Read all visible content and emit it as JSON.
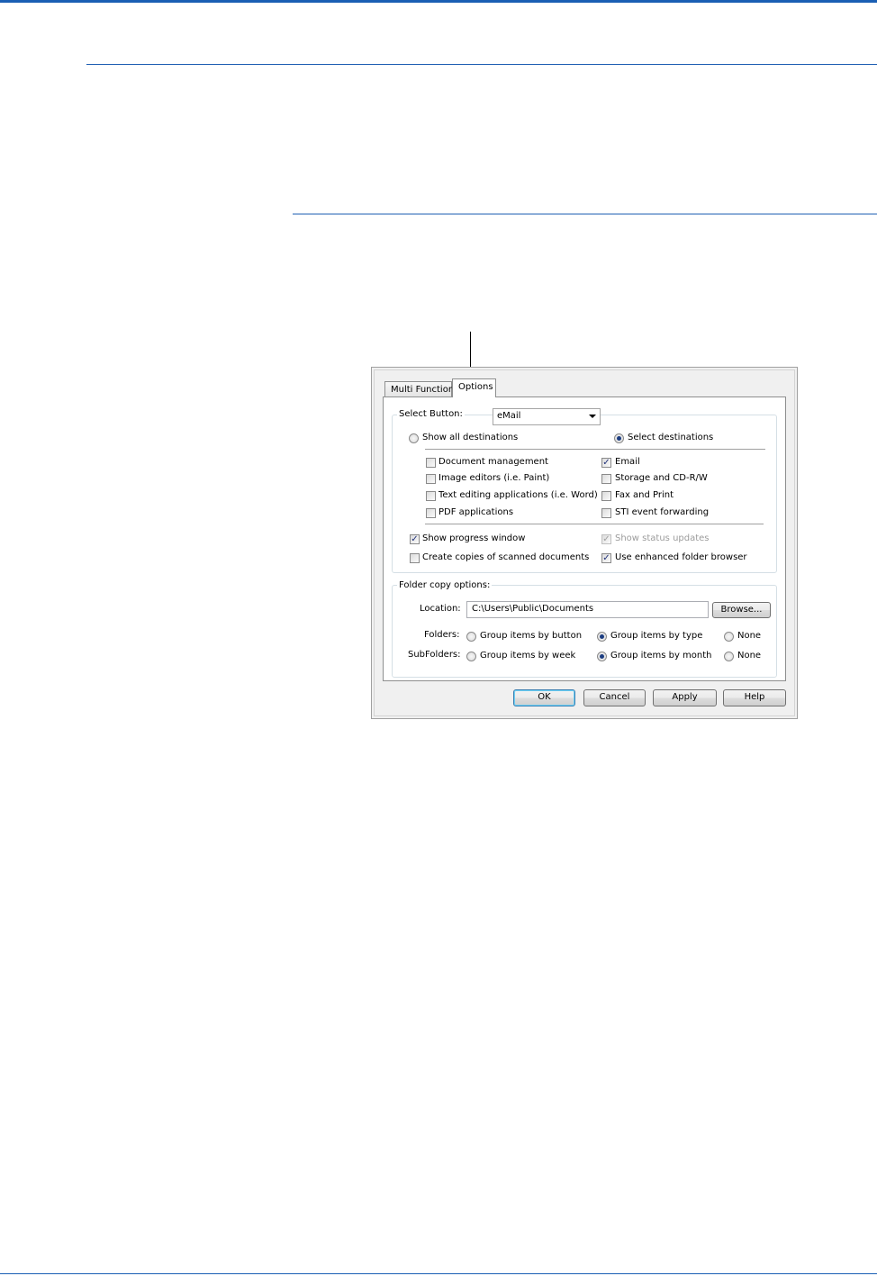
{
  "dialog": {
    "tabs": [
      "Multi Function",
      "Options"
    ],
    "select_button": {
      "label": "Select Button:",
      "value": "eMail",
      "show_all_label": "Show all destinations",
      "select_dest_label": "Select destinations",
      "selected": "Select destinations",
      "destinations": [
        {
          "label": "Document management",
          "checked": false
        },
        {
          "label": "Image editors (i.e. Paint)",
          "checked": false
        },
        {
          "label": "Text editing applications (i.e. Word)",
          "checked": false
        },
        {
          "label": "PDF applications",
          "checked": false
        },
        {
          "label": "Email",
          "checked": true
        },
        {
          "label": "Storage and CD-R/W",
          "checked": false
        },
        {
          "label": "Fax and Print",
          "checked": false
        },
        {
          "label": "STI event forwarding",
          "checked": false
        }
      ],
      "show_progress": {
        "label": "Show progress window",
        "checked": true
      },
      "create_copies": {
        "label": "Create copies of scanned documents",
        "checked": false
      },
      "show_status": {
        "label": "Show status updates",
        "checked": true,
        "disabled": true
      },
      "enhanced_browser": {
        "label": "Use enhanced folder browser",
        "checked": true
      }
    },
    "folder": {
      "legend": "Folder copy options:",
      "location_label": "Location:",
      "location_value": "C:\\Users\\Public\\Documents",
      "browse_label": "Browse...",
      "folders_label": "Folders:",
      "subfolders_label": "SubFolders:",
      "folders_options": [
        "Group items by button",
        "Group items by type",
        "None"
      ],
      "folders_selected": "Group items by type",
      "subfolders_options": [
        "Group items by week",
        "Group items by month",
        "None"
      ],
      "subfolders_selected": "Group items by month"
    },
    "buttons": {
      "ok": "OK",
      "cancel": "Cancel",
      "apply": "Apply",
      "help": "Help"
    }
  },
  "colors": {
    "rule": "#1f5fb3",
    "dialog_bg": "#f0f0f0",
    "check_mark": "#22337a"
  }
}
